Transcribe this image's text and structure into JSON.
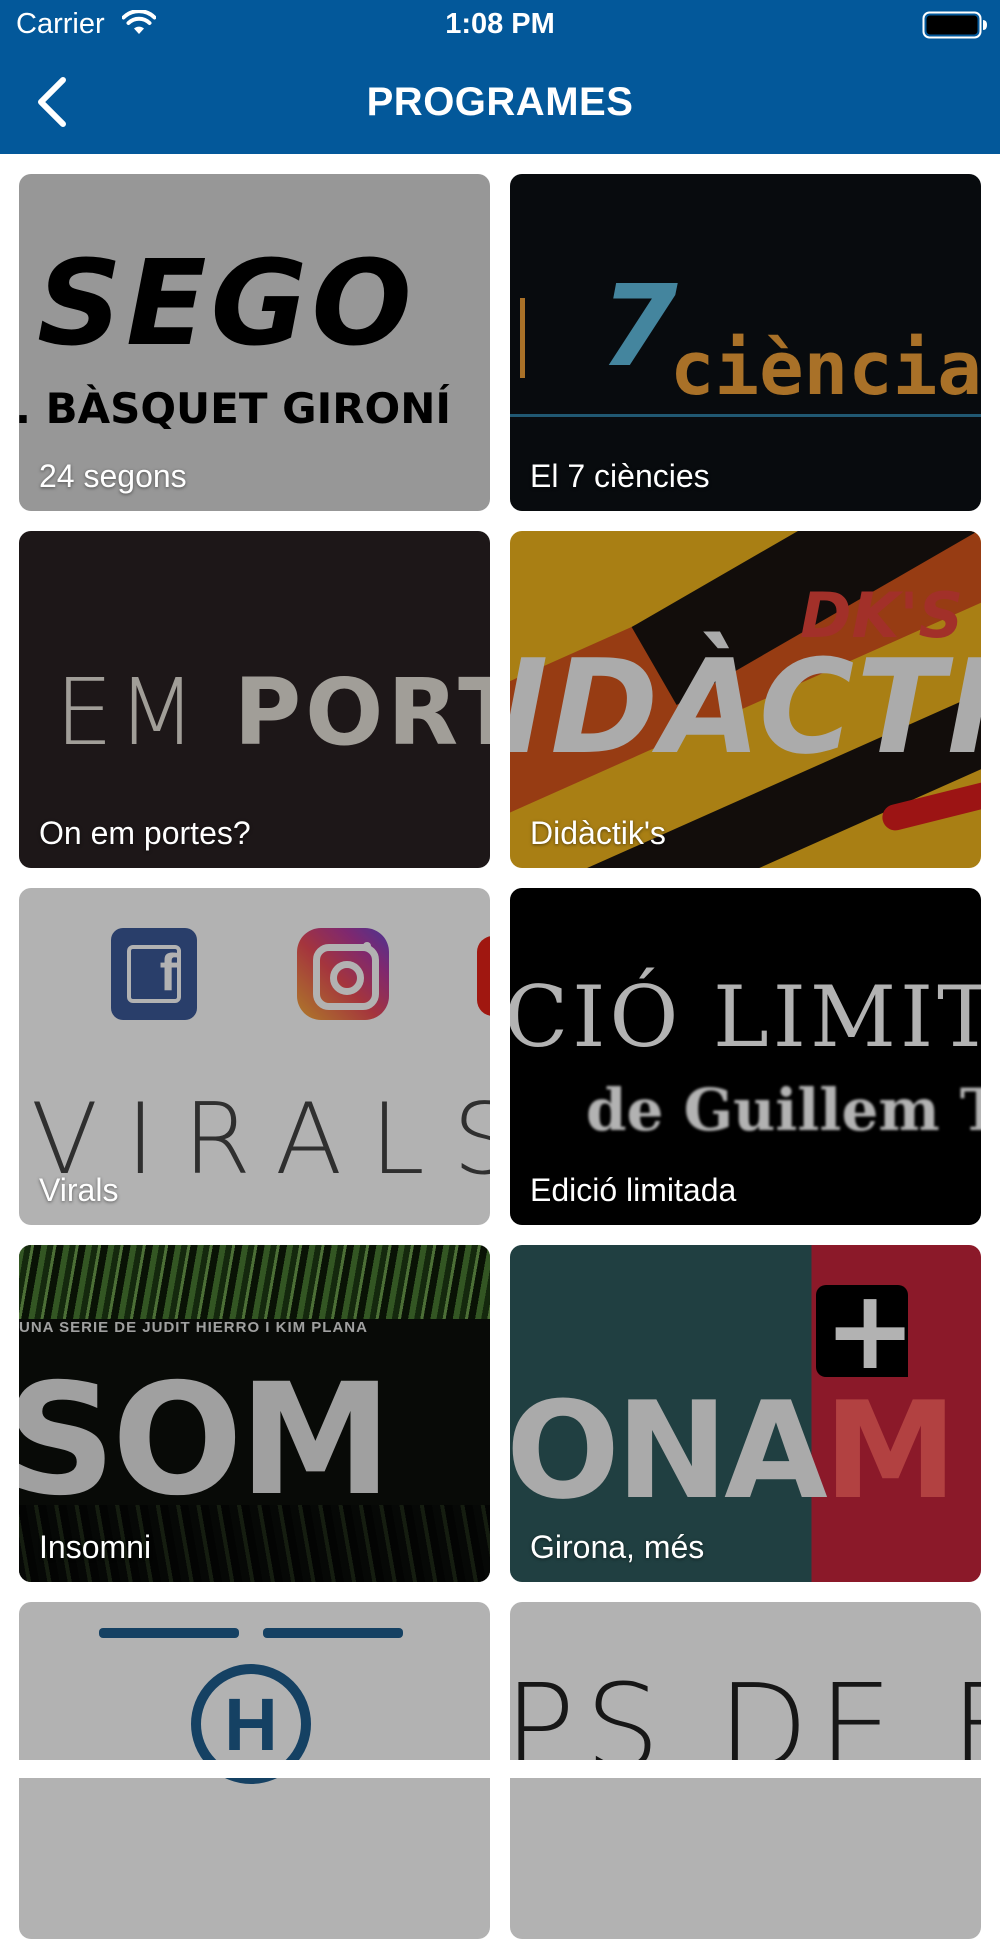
{
  "status_bar": {
    "carrier": "Carrier",
    "time": "1:08 PM"
  },
  "header": {
    "title": "PROGRAMES"
  },
  "programs": [
    {
      "label": "24 segons",
      "art_top": "SEGO",
      "art_bottom": ". BÀSQUET GIRONÍ"
    },
    {
      "label": "El 7 ciències",
      "art_number": "7",
      "art_word": "ciència"
    },
    {
      "label": "On em portes?",
      "art_light": "EM ",
      "art_bold": "PORTE"
    },
    {
      "label": "Didàctik's",
      "art_small": "DK'S",
      "art_word": "IDÀCTIK"
    },
    {
      "label": "Virals",
      "art_word": "VIRALS",
      "art_fb": "f"
    },
    {
      "label": "Edició limitada",
      "art_line1": "CIÓ  LIMITA",
      "art_line2": "de  Guillem Te"
    },
    {
      "label": "Insomni",
      "art_top": "UNA SERIE DE JUDIT HIERRO I KIM PLANA",
      "art_word": "SOM"
    },
    {
      "label": "Girona, més",
      "art_word": "ONA",
      "art_word_red": "M",
      "art_plus": "+"
    },
    {
      "label": "",
      "art_letter": "H"
    },
    {
      "label": "",
      "art_word": "PS DE EI"
    }
  ],
  "colors": {
    "header_bg": "#03589a",
    "card_overlay": "rgba(0,0,0,0.30)",
    "text_on_dark": "#ffffff"
  },
  "icons": {
    "back": "chevron-left-icon",
    "wifi": "wifi-icon",
    "battery": "battery-icon"
  }
}
